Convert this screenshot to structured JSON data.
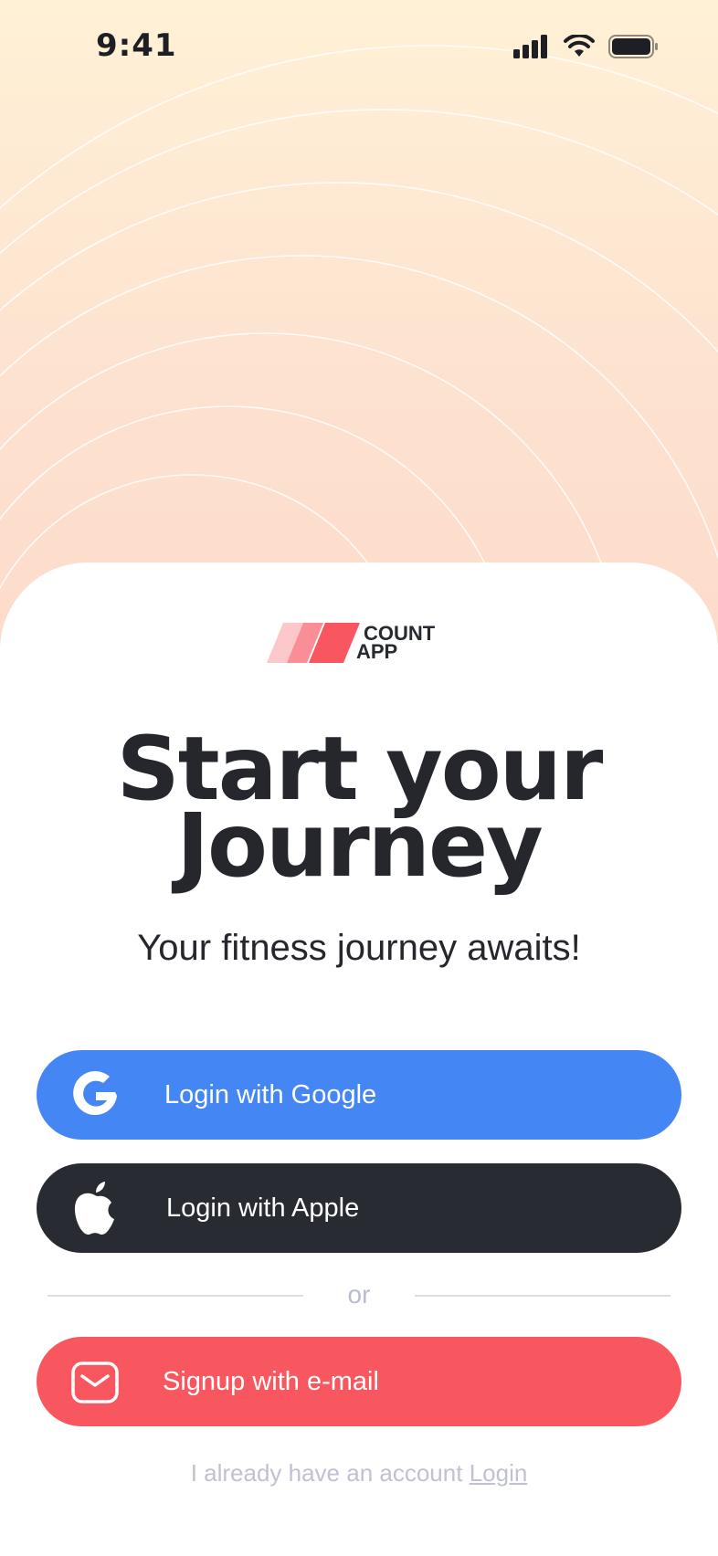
{
  "status_bar": {
    "time": "9:41"
  },
  "logo": {
    "line1": "COUNT",
    "line2": "APP"
  },
  "headline": {
    "line1": "Start your",
    "line2": "Journey"
  },
  "subtitle": "Your fitness journey awaits!",
  "buttons": {
    "google": {
      "label": "Login with Google",
      "icon": "google-icon",
      "color": "#4486f4"
    },
    "apple": {
      "label": "Login with Apple",
      "icon": "apple-icon",
      "color": "#282b32"
    },
    "email": {
      "label": "Signup with e-mail",
      "icon": "mail-icon",
      "color": "#f85760"
    }
  },
  "divider_text": "or",
  "footer": {
    "text": "I already have an account",
    "link": "Login"
  },
  "colors": {
    "accent": "#f85760",
    "text_dark": "#25272d",
    "muted": "#c0c1d1"
  }
}
